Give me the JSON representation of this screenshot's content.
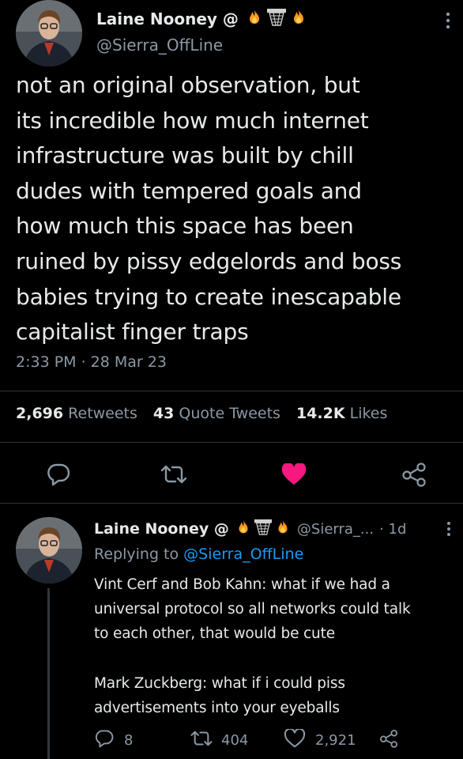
{
  "main_tweet": {
    "author_name": "Laine Nooney @",
    "handle": "@Sierra_OffLine",
    "text_lines": [
      "not an original observation, but",
      "its incredible how much internet",
      "infrastructure was built by chill",
      "dudes with tempered goals and",
      "how much this space has been",
      "ruined by pissy edgelords and boss",
      "babies trying to create inescapable",
      "capitalist finger traps"
    ],
    "timestamp": "2:33 PM · 28 Mar 23",
    "stats": {
      "retweets_count": "2,696",
      "retweets_label": "Retweets",
      "quotes_count": "43",
      "quotes_label": "Quote Tweets",
      "likes_count": "14.2K",
      "likes_label": "Likes"
    },
    "liked": true
  },
  "reply": {
    "author_name": "Laine Nooney @",
    "handle": "@Sierra_...",
    "time": "· 1d",
    "replying_prefix": "Replying to",
    "replying_to": "@Sierra_OffLine",
    "text_lines": [
      "Vint Cerf and Bob Kahn: what if we had a",
      "universal protocol so all networks could talk",
      "to each other, that would be cute",
      "",
      "Mark Zuckberg: what if i could piss",
      "advertisements into your eyeballs"
    ],
    "actions": {
      "replies": "8",
      "retweets": "404",
      "likes": "2,921"
    }
  },
  "colors": {
    "background": "#000000",
    "text": "#e7e9ea",
    "muted": "#8b98a5",
    "accent": "#1d9bf0",
    "like": "#f91880"
  },
  "icons": [
    "fire-emoji",
    "basketball-hoop-emoji",
    "more-icon",
    "reply-icon",
    "retweet-icon",
    "heart-icon",
    "share-icon"
  ]
}
